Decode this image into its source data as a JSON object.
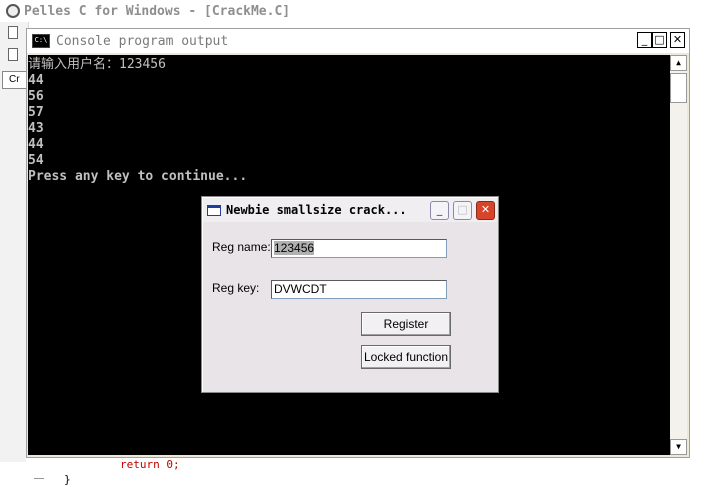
{
  "ide": {
    "title": "Pelles C for Windows - [CrackMe.C]",
    "tab_label": "Cr"
  },
  "console": {
    "title": "Console program output",
    "icon_label": "C:\\",
    "lines": [
      "请输入用户名：123456",
      "44",
      "56",
      "57",
      "43",
      "44",
      "54",
      "Press any key to continue..."
    ]
  },
  "dialog": {
    "title": "Newbie smallsize crack...",
    "reg_name_label": "Reg name:",
    "reg_name_value": "123456",
    "reg_key_label": "Reg key:",
    "reg_key_value": "DVWCDT",
    "register_button": "Register",
    "locked_button": "Locked function"
  },
  "editor": {
    "return_keyword": "return",
    "return_value": "0",
    "closing_brace": "}"
  },
  "colors": {
    "console_bg": "#000000",
    "console_text": "#c0c0c0",
    "close_button": "#d8442a",
    "keyword": "#c00000"
  }
}
